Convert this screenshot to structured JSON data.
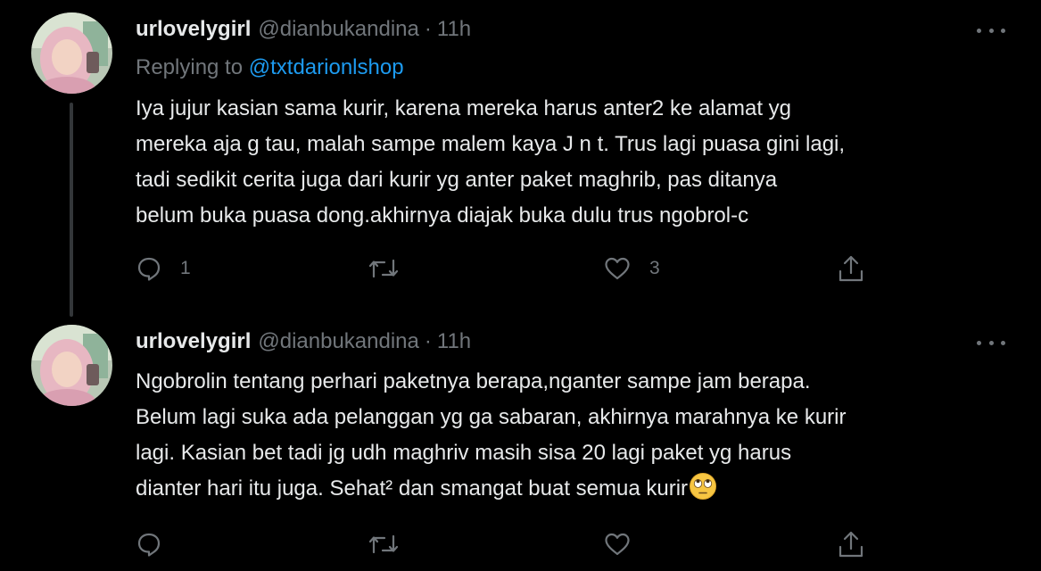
{
  "tweets": [
    {
      "author_name": "urlovelygirl",
      "author_handle": "@dianbukandina",
      "separator": "·",
      "time": "11h",
      "replying_prefix": "Replying to",
      "replying_to": "@txtdarionlshop",
      "text_lines": [
        "Iya jujur kasian sama kurir, karena mereka harus anter2 ke alamat yg",
        "mereka aja g tau, malah sampe malem kaya J n t. Trus lagi puasa gini lagi,",
        "tadi sedikit cerita juga dari kurir yg anter paket maghrib, pas ditanya",
        "belum buka puasa dong.akhirnya diajak buka dulu trus ngobrol-c"
      ],
      "reply_count": "1",
      "retweet_count": "",
      "like_count": "3"
    },
    {
      "author_name": "urlovelygirl",
      "author_handle": "@dianbukandina",
      "separator": "·",
      "time": "11h",
      "text_lines": [
        "Ngobrolin tentang perhari paketnya berapa,nganter sampe jam berapa.",
        "Belum lagi suka ada pelanggan yg ga sabaran, akhirnya marahnya ke kurir",
        "lagi. Kasian bet tadi jg udh maghriv masih sisa 20 lagi paket yg harus",
        "dianter hari itu juga. Sehat² dan smangat buat semua kurir"
      ],
      "emoji": "face-with-rolling-eyes",
      "reply_count": "",
      "retweet_count": "",
      "like_count": ""
    }
  ],
  "colors": {
    "background": "#000000",
    "primary_text": "#e7e9ea",
    "secondary_text": "#71767b",
    "link": "#1d9bf0",
    "thread_line": "#333639"
  },
  "icons": [
    "avatar",
    "more-icon",
    "reply-icon",
    "retweet-icon",
    "like-icon",
    "share-icon"
  ]
}
